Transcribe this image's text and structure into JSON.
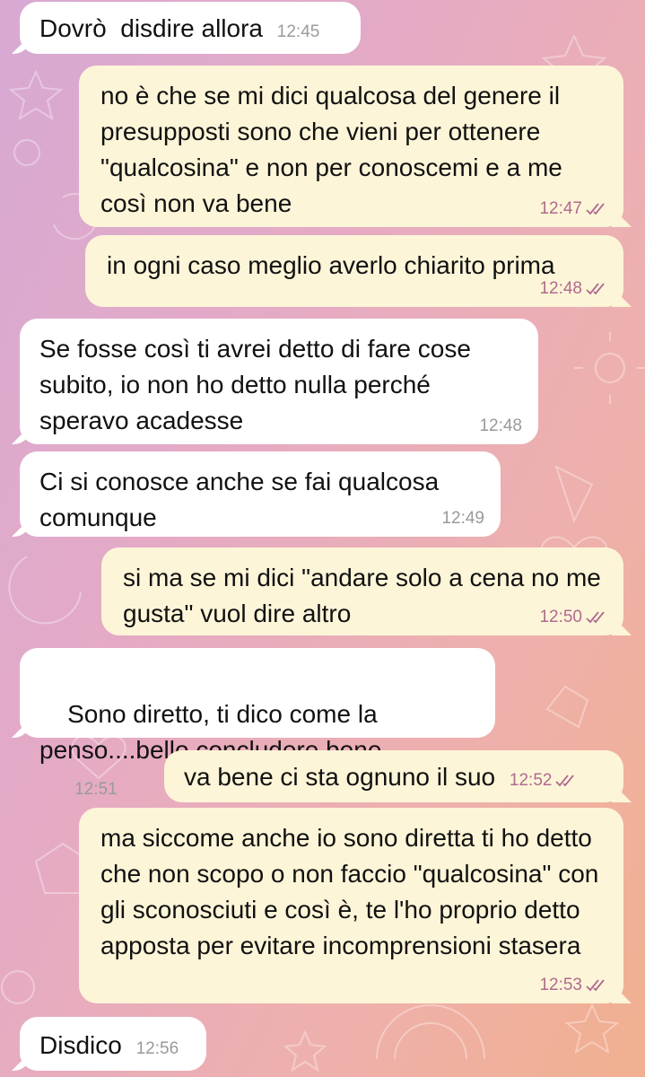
{
  "messages": [
    {
      "direction": "in",
      "text": "Dovrò  disdire allora",
      "time": "12:45"
    },
    {
      "direction": "out",
      "text": "no è che se mi dici qualcosa del genere il presupposti sono che vieni per ottenere \"qualcosina\" e non per conoscemi e a me così non va bene",
      "time": "12:47",
      "status": "read"
    },
    {
      "direction": "out",
      "text": "in ogni caso meglio averlo chiarito prima",
      "time": "12:48",
      "status": "read"
    },
    {
      "direction": "in",
      "text": "Se fosse così ti avrei detto di fare cose subito, io non ho detto nulla perché speravo acadesse",
      "time": "12:48"
    },
    {
      "direction": "in",
      "text": "Ci si conosce anche se fai qualcosa comunque",
      "time": "12:49"
    },
    {
      "direction": "out",
      "text": "si ma se mi dici \"andare solo a cena no me gusta\" vuol dire altro",
      "time": "12:50",
      "status": "read"
    },
    {
      "direction": "in",
      "text": "Sono diretto, ti dico come la penso....bello concludere bene",
      "time": "12:51"
    },
    {
      "direction": "out",
      "text": "va bene ci sta ognuno il suo",
      "time": "12:52",
      "status": "read"
    },
    {
      "direction": "out",
      "text": "ma siccome anche io sono diretta ti ho detto che non scopo o non faccio \"qualcosina\" con gli sconosciuti e così è, te l'ho proprio detto apposta per evitare incomprensioni stasera",
      "time": "12:53",
      "status": "read"
    },
    {
      "direction": "in",
      "text": "Disdico",
      "time": "12:56"
    }
  ]
}
